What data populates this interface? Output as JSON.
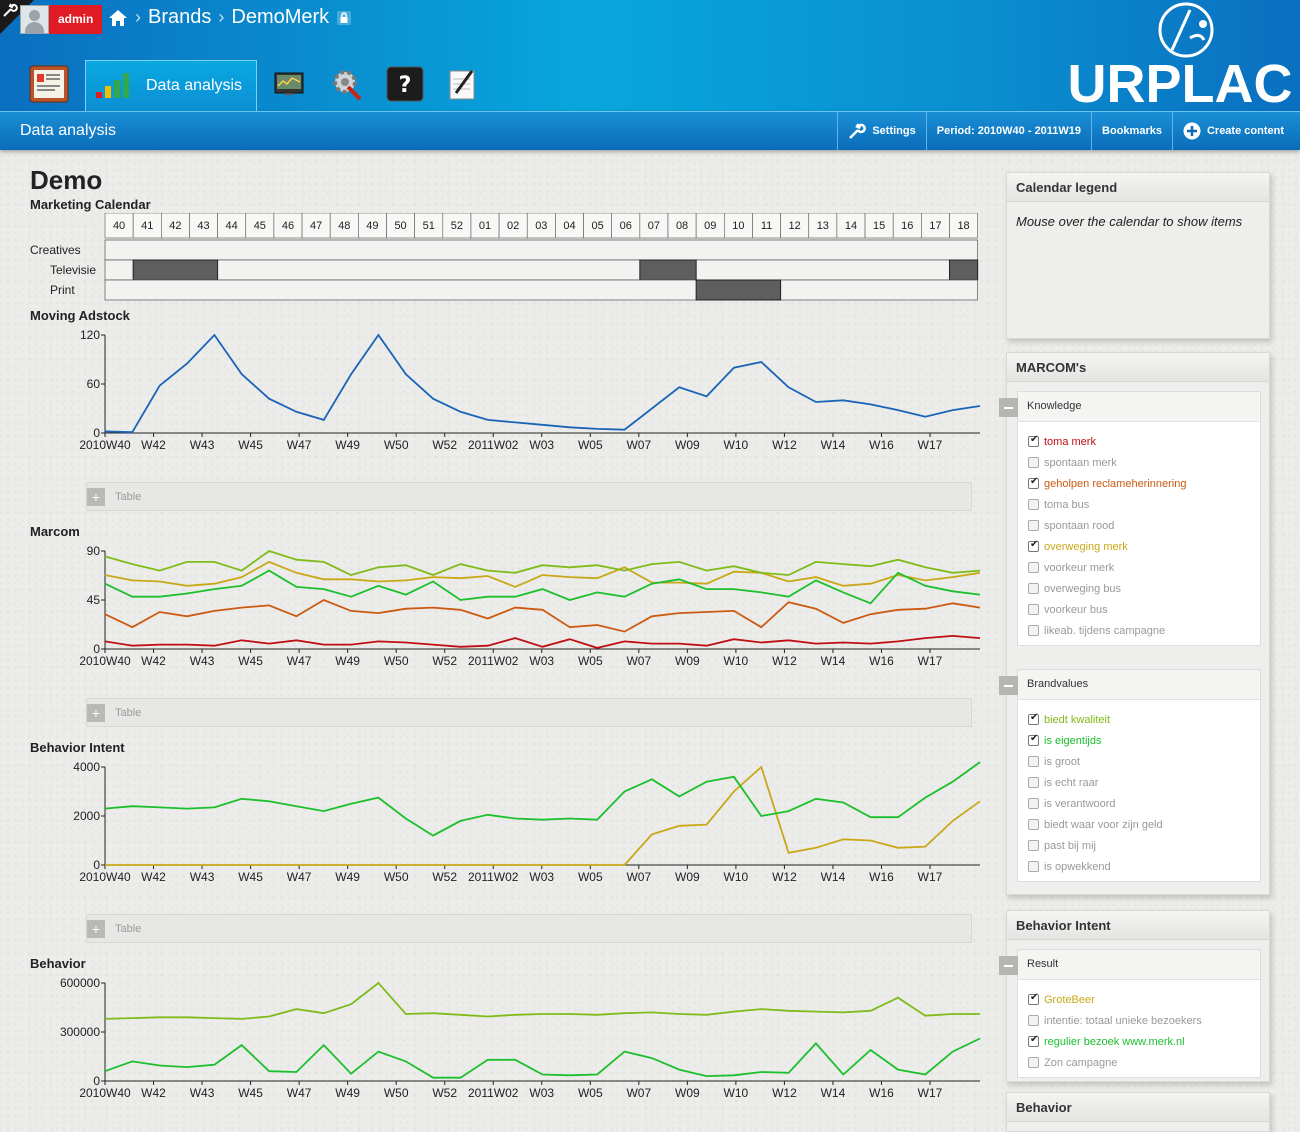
{
  "header": {
    "user": "admin",
    "breadcrumb": [
      "Brands",
      "DemoMerk"
    ],
    "active_tab": "Data analysis",
    "logo_text": "SURPLACE",
    "colors": {
      "bar": "#08a6dc",
      "admin": "#e01b24"
    }
  },
  "subbar": {
    "title": "Data analysis",
    "settings": "Settings",
    "period": "Period: 2010W40 - 2011W19",
    "bookmarks": "Bookmarks",
    "create": "Create content"
  },
  "page": {
    "title": "Demo"
  },
  "calendar": {
    "title": "Marketing Calendar",
    "weeks": [
      "40",
      "41",
      "42",
      "43",
      "44",
      "45",
      "46",
      "47",
      "48",
      "49",
      "50",
      "51",
      "52",
      "01",
      "02",
      "03",
      "04",
      "05",
      "06",
      "07",
      "08",
      "09",
      "10",
      "11",
      "12",
      "13",
      "14",
      "15",
      "16",
      "17",
      "18"
    ],
    "rows": [
      {
        "label": "Creatives",
        "indent": false,
        "blocks": []
      },
      {
        "label": "Televisie",
        "indent": true,
        "blocks": [
          [
            1,
            3
          ],
          [
            19,
            20
          ],
          [
            30,
            30
          ]
        ]
      },
      {
        "label": "Print",
        "indent": true,
        "blocks": [
          [
            21,
            23
          ]
        ]
      }
    ]
  },
  "xaxis_labels": [
    "2010W40",
    "W42",
    "W43",
    "W45",
    "W47",
    "W49",
    "W50",
    "W52",
    "2011W02",
    "W03",
    "W05",
    "W07",
    "W09",
    "W10",
    "W12",
    "W14",
    "W16",
    "W17"
  ],
  "table_label": "Table",
  "chart_data": [
    {
      "type": "line",
      "title": "Moving Adstock",
      "ylim": [
        0,
        120
      ],
      "yticks": [
        "0",
        "60",
        "120"
      ],
      "series": [
        {
          "color": "#1a64b8",
          "values": [
            2,
            1,
            58,
            85,
            120,
            72,
            42,
            26,
            16,
            72,
            120,
            72,
            42,
            26,
            16,
            13,
            10,
            7,
            5,
            4,
            30,
            56,
            45,
            80,
            87,
            56,
            38,
            40,
            35,
            28,
            20,
            28,
            33
          ]
        }
      ]
    },
    {
      "type": "line",
      "title": "Marcom",
      "ylim": [
        0,
        90
      ],
      "yticks": [
        "0",
        "45",
        "90"
      ],
      "series": [
        {
          "name": "toma merk",
          "color": "#c00e15",
          "values": [
            7,
            3,
            4,
            4,
            3,
            8,
            5,
            8,
            4,
            4,
            7,
            6,
            4,
            2,
            3,
            10,
            2,
            9,
            1,
            7,
            5,
            5,
            3,
            9,
            6,
            8,
            5,
            6,
            5,
            7,
            10,
            12,
            10
          ]
        },
        {
          "name": "geholpen reclameherinnering",
          "color": "#cc5a10",
          "values": [
            32,
            20,
            34,
            30,
            35,
            38,
            40,
            30,
            45,
            35,
            33,
            37,
            38,
            36,
            28,
            38,
            36,
            20,
            22,
            16,
            30,
            33,
            34,
            35,
            20,
            43,
            37,
            24,
            32,
            36,
            37,
            42,
            38
          ]
        },
        {
          "name": "overweging merk",
          "color": "#c9a818",
          "values": [
            68,
            63,
            62,
            58,
            60,
            66,
            80,
            70,
            64,
            64,
            62,
            63,
            66,
            65,
            67,
            57,
            68,
            66,
            65,
            75,
            61,
            61,
            60,
            71,
            70,
            62,
            66,
            58,
            60,
            68,
            63,
            66,
            70
          ]
        },
        {
          "name": "biedt kwaliteit",
          "color": "#7fbb19",
          "values": [
            85,
            78,
            72,
            80,
            80,
            72,
            90,
            82,
            80,
            68,
            75,
            77,
            68,
            78,
            72,
            70,
            77,
            75,
            77,
            72,
            78,
            80,
            72,
            76,
            70,
            68,
            80,
            78,
            76,
            82,
            75,
            70,
            72
          ]
        },
        {
          "name": "is eigentijds",
          "color": "#1cbf2c",
          "values": [
            60,
            48,
            48,
            51,
            55,
            58,
            72,
            57,
            55,
            48,
            58,
            50,
            62,
            45,
            48,
            48,
            55,
            45,
            52,
            48,
            60,
            64,
            55,
            55,
            52,
            48,
            63,
            52,
            42,
            70,
            58,
            53,
            50
          ]
        }
      ]
    },
    {
      "type": "line",
      "title": "Behavior Intent",
      "ylim": [
        0,
        4000
      ],
      "yticks": [
        "0",
        "2000",
        "4000"
      ],
      "series": [
        {
          "name": "GroteBeer",
          "color": "#c9a818",
          "values": [
            0,
            0,
            0,
            0,
            0,
            0,
            0,
            0,
            0,
            0,
            0,
            0,
            0,
            0,
            0,
            0,
            0,
            0,
            0,
            0,
            1250,
            1600,
            1650,
            3000,
            4000,
            500,
            700,
            1050,
            1000,
            700,
            750,
            1800,
            2600
          ]
        },
        {
          "name": "regulier bezoek www.merk.nl",
          "color": "#1cbf2c",
          "values": [
            2300,
            2400,
            2350,
            2300,
            2350,
            2700,
            2600,
            2400,
            2200,
            2500,
            2750,
            1900,
            1200,
            1800,
            2050,
            1900,
            1850,
            1900,
            1850,
            3000,
            3500,
            2800,
            3400,
            3600,
            2000,
            2200,
            2700,
            2550,
            1950,
            1950,
            2750,
            3400,
            4200
          ]
        }
      ]
    },
    {
      "type": "line",
      "title": "Behavior",
      "ylim": [
        0,
        600000
      ],
      "yticks": [
        "0",
        "300000",
        "600000"
      ],
      "series": [
        {
          "color": "#7fbb19",
          "values": [
            380000,
            385000,
            390000,
            390000,
            385000,
            380000,
            395000,
            440000,
            415000,
            470000,
            600000,
            410000,
            415000,
            405000,
            395000,
            405000,
            410000,
            410000,
            405000,
            415000,
            420000,
            410000,
            405000,
            425000,
            440000,
            430000,
            425000,
            420000,
            430000,
            510000,
            400000,
            410000,
            410000
          ]
        },
        {
          "color": "#1cbf2c",
          "values": [
            60000,
            120000,
            95000,
            85000,
            100000,
            220000,
            60000,
            55000,
            220000,
            45000,
            180000,
            120000,
            20000,
            20000,
            130000,
            130000,
            40000,
            35000,
            40000,
            180000,
            140000,
            70000,
            30000,
            35000,
            55000,
            50000,
            230000,
            40000,
            190000,
            70000,
            40000,
            180000,
            260000
          ]
        }
      ]
    }
  ],
  "sidebar": {
    "legend": {
      "title": "Calendar legend",
      "text": "Mouse over the calendar to show items"
    },
    "marcom": {
      "title": "MARCOM's",
      "groups": [
        {
          "title": "Knowledge",
          "items": [
            {
              "label": "toma merk",
              "checked": true,
              "color": "#c00e15"
            },
            {
              "label": "spontaan merk",
              "checked": false,
              "color": "#999999"
            },
            {
              "label": "geholpen reclameherinnering",
              "checked": true,
              "color": "#cc5a10"
            },
            {
              "label": "toma bus",
              "checked": false,
              "color": "#999999"
            },
            {
              "label": "spontaan rood",
              "checked": false,
              "color": "#999999"
            },
            {
              "label": "overweging merk",
              "checked": true,
              "color": "#c9a818"
            },
            {
              "label": "voorkeur merk",
              "checked": false,
              "color": "#999999"
            },
            {
              "label": "overweging bus",
              "checked": false,
              "color": "#999999"
            },
            {
              "label": "voorkeur bus",
              "checked": false,
              "color": "#999999"
            },
            {
              "label": "likeab. tijdens campagne",
              "checked": false,
              "color": "#999999"
            }
          ]
        },
        {
          "title": "Brandvalues",
          "items": [
            {
              "label": "biedt kwaliteit",
              "checked": true,
              "color": "#7fbb19"
            },
            {
              "label": "is eigentijds",
              "checked": true,
              "color": "#1cbf2c"
            },
            {
              "label": "is groot",
              "checked": false,
              "color": "#999999"
            },
            {
              "label": "is echt raar",
              "checked": false,
              "color": "#999999"
            },
            {
              "label": "is verantwoord",
              "checked": false,
              "color": "#999999"
            },
            {
              "label": "biedt waar voor zijn geld",
              "checked": false,
              "color": "#999999"
            },
            {
              "label": "past bij mij",
              "checked": false,
              "color": "#999999"
            },
            {
              "label": "is opwekkend",
              "checked": false,
              "color": "#999999"
            }
          ]
        }
      ]
    },
    "intent": {
      "title": "Behavior Intent",
      "groups": [
        {
          "title": "Result",
          "items": [
            {
              "label": "GroteBeer",
              "checked": true,
              "color": "#c9a818"
            },
            {
              "label": "intentie: totaal unieke bezoekers",
              "checked": false,
              "color": "#999999"
            },
            {
              "label": "regulier bezoek www.merk.nl",
              "checked": true,
              "color": "#1cbf2c"
            },
            {
              "label": "Zon campagne",
              "checked": false,
              "color": "#999999"
            }
          ]
        }
      ]
    },
    "behavior": {
      "title": "Behavior"
    }
  }
}
